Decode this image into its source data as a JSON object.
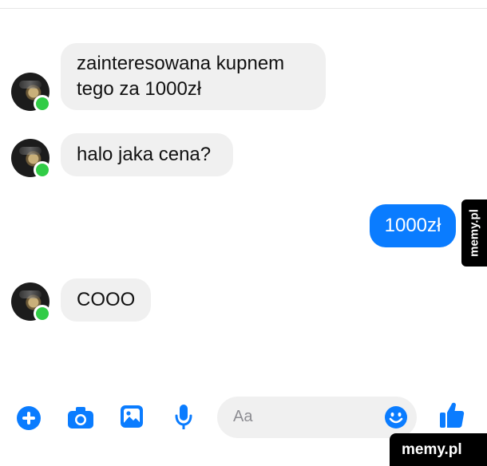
{
  "messages": [
    {
      "direction": "in",
      "lines": [
        "zainteresowana kupnem",
        "tego za 1000zł"
      ]
    },
    {
      "direction": "in",
      "lines": [
        "halo jaka cena?"
      ]
    },
    {
      "direction": "out",
      "lines": [
        "1000zł"
      ]
    },
    {
      "direction": "in",
      "lines": [
        "COOO"
      ]
    }
  ],
  "composer": {
    "placeholder": "Aa",
    "icons": [
      "plus-icon",
      "camera-icon",
      "image-icon",
      "microphone-icon",
      "emoji-icon",
      "thumbs-up-icon"
    ]
  },
  "watermark": {
    "side_text": "memy.pl",
    "bottom_text": "memy.pl"
  },
  "colors": {
    "outgoing_bubble": "#0a7cff",
    "incoming_bubble": "#f0f0f0",
    "accent": "#0a7cff",
    "online": "#31cc46"
  }
}
